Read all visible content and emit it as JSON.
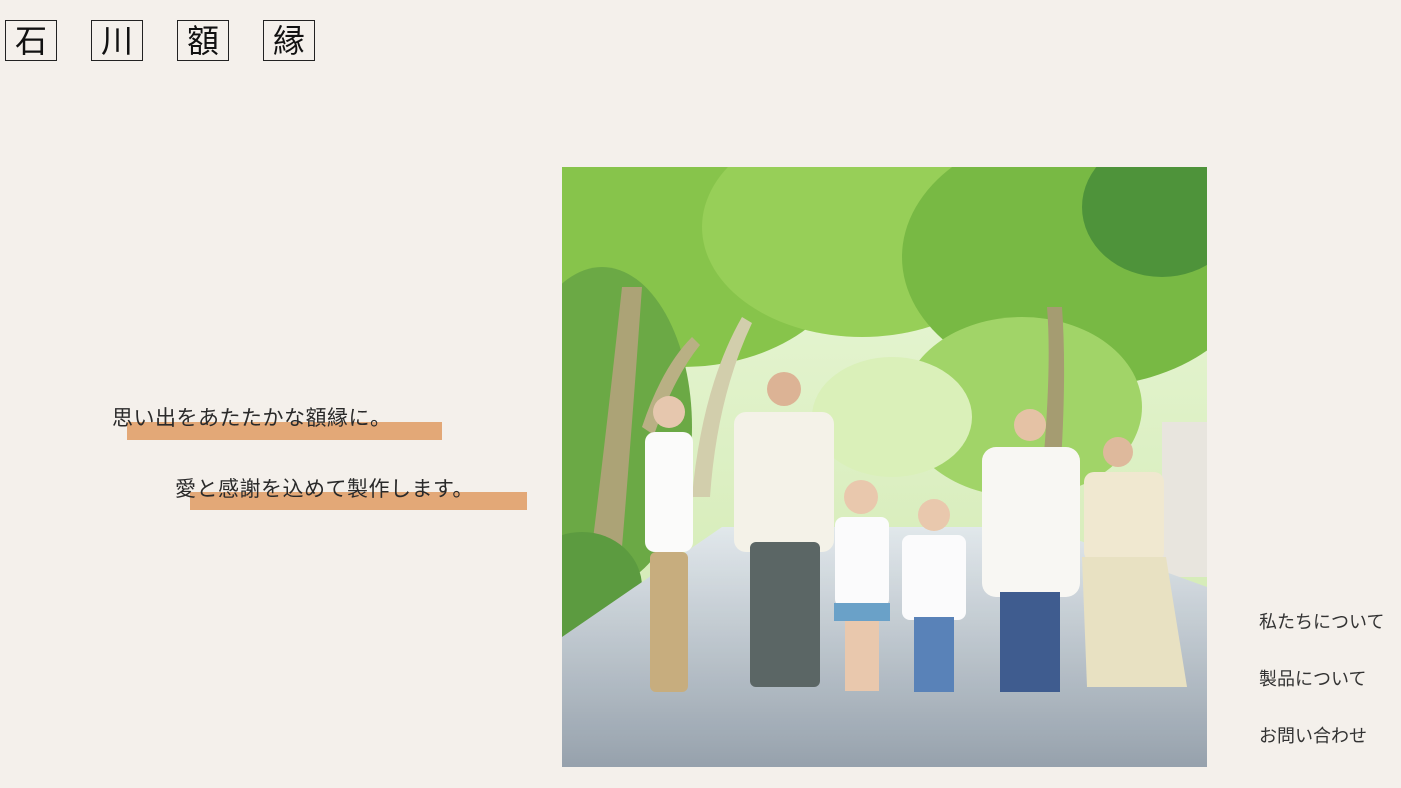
{
  "logo": {
    "chars": [
      "石",
      "川",
      "額",
      "縁"
    ]
  },
  "hero": {
    "taglines": [
      "思い出をあたたかな額縁に。",
      "愛と感謝を込めて製作します。"
    ],
    "highlight_color": "#e3a877",
    "image_subject": "family-photo"
  },
  "nav": {
    "items": [
      "私たちについて",
      "製品について",
      "お問い合わせ"
    ]
  },
  "colors": {
    "background": "#f4f0eb",
    "text": "#2a2a2a"
  }
}
